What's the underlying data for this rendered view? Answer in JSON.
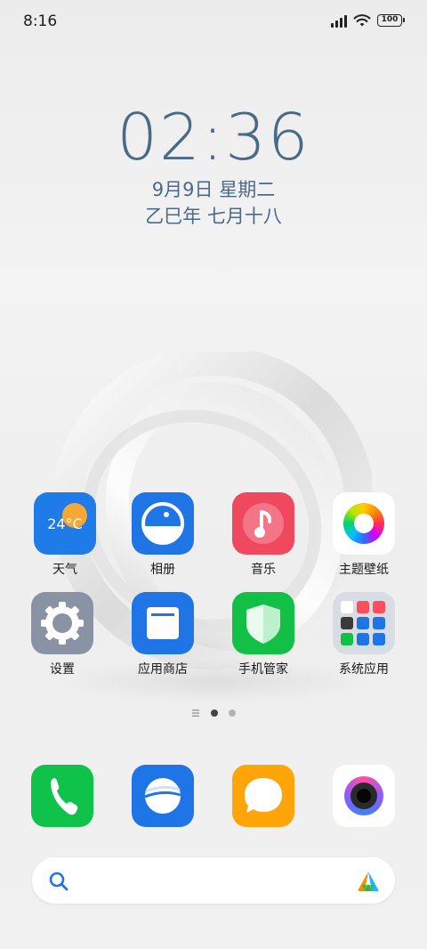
{
  "status": {
    "time": "8:16",
    "battery_level": "100",
    "icons": [
      "signal-icon",
      "wifi-icon",
      "battery-icon"
    ]
  },
  "clock": {
    "time": "02:36",
    "date": "9月9日 星期二",
    "lunar": "乙巳年 七月十八"
  },
  "apps": [
    {
      "label": "天气",
      "icon": "weather-icon",
      "temperature": "24°C"
    },
    {
      "label": "相册",
      "icon": "gallery-icon"
    },
    {
      "label": "音乐",
      "icon": "music-icon"
    },
    {
      "label": "主题壁纸",
      "icon": "themes-icon"
    },
    {
      "label": "设置",
      "icon": "settings-icon"
    },
    {
      "label": "应用商店",
      "icon": "app-store-icon"
    },
    {
      "label": "手机管家",
      "icon": "security-icon"
    },
    {
      "label": "系统应用",
      "icon": "system-apps-folder-icon"
    }
  ],
  "page_indicator": {
    "pages": 2,
    "current": 1
  },
  "dock": [
    {
      "icon": "phone-icon"
    },
    {
      "icon": "browser-icon"
    },
    {
      "icon": "messages-icon"
    },
    {
      "icon": "camera-icon"
    }
  ],
  "search": {
    "icon": "search-icon",
    "assistant_icon": "assistant-icon"
  },
  "colors": {
    "clock_text": "#4b6a88",
    "weather": "#1e7be8",
    "gallery": "#1f75e5",
    "music": "#f0485e",
    "settings": "#8a93a3",
    "app_store": "#1f75e5",
    "security": "#12c046",
    "phone": "#0fc24a",
    "browser": "#1f75e5",
    "messages": "#ffa50a"
  }
}
